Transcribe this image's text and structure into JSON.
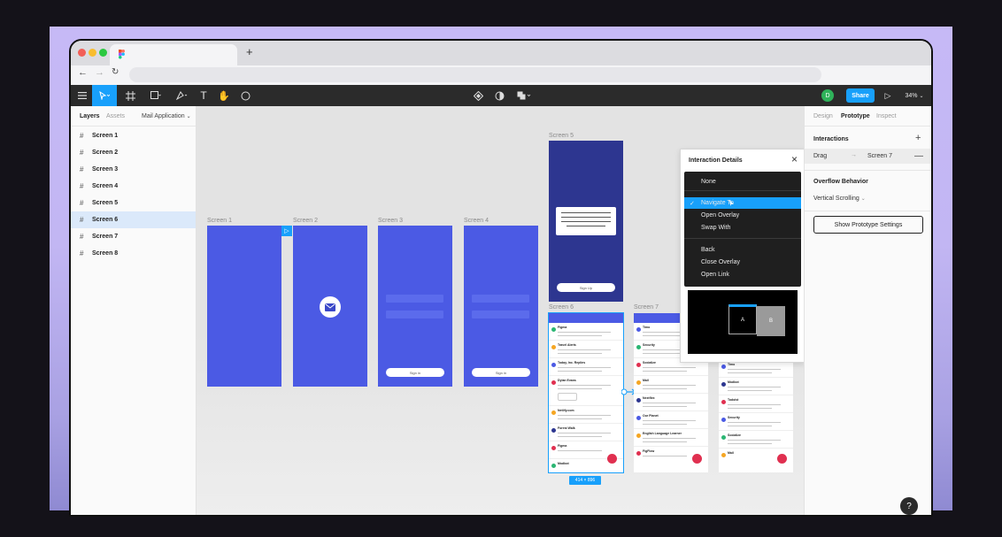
{
  "toolbar": {
    "share_label": "Share",
    "zoom": "34%",
    "avatar_letter": "D"
  },
  "left_panel": {
    "tabs": [
      "Layers",
      "Assets"
    ],
    "page_name": "Mail Application",
    "layers": [
      "Screen 1",
      "Screen 2",
      "Screen 3",
      "Screen 4",
      "Screen 5",
      "Screen 6",
      "Screen 7",
      "Screen 8"
    ],
    "selected_layer": "Screen 6"
  },
  "canvas": {
    "frames": {
      "s1": "Screen 1",
      "s2": "Screen 2",
      "s3": "Screen 3",
      "s4": "Screen 4",
      "s5": "Screen 5",
      "s6": "Screen 6",
      "s7": "Screen 7"
    },
    "sign_in_label": "Sign in",
    "sign_up_label": "Sign Up",
    "dimension_badge": "414 × 896",
    "mail_senders": [
      "Figma",
      "Travel Alerts",
      "Today, Inc. Replies",
      "Dylan Evans",
      "Netlify.com",
      "Forest Walk",
      "Figma",
      "Modbot"
    ],
    "mail_senders_2": [
      "Timo",
      "Security",
      "Socialize",
      "Mail",
      "Nextflex",
      "Our Planet",
      "English Language Learner",
      "FigFlow"
    ],
    "mail_senders_3": [
      "Timo",
      "Security",
      "Socialize",
      "Mail",
      "Modbot",
      "Todoist",
      "Security",
      "Socialize",
      "Mail"
    ]
  },
  "interaction_menu": {
    "title": "Interaction Details",
    "options_group1": [
      "None",
      "Navigate To",
      "Open Overlay",
      "Swap With"
    ],
    "options_group2": [
      "Back",
      "Close Overlay",
      "Open Link"
    ],
    "selected": "Navigate To",
    "preview_a": "A",
    "preview_b": "B"
  },
  "right_panel": {
    "tabs": [
      "Design",
      "Prototype",
      "Inspect"
    ],
    "active_tab": "Prototype",
    "interactions_title": "Interactions",
    "trigger": "Drag",
    "destination": "Screen 7",
    "overflow_title": "Overflow Behavior",
    "overflow_value": "Vertical Scrolling",
    "settings_button": "Show Prototype Settings"
  },
  "colors": {
    "accent": "#18a0fb",
    "frame_blue": "#4b5ae4",
    "frame_dark": "#2d3690",
    "avatar": "#2fb25a"
  }
}
